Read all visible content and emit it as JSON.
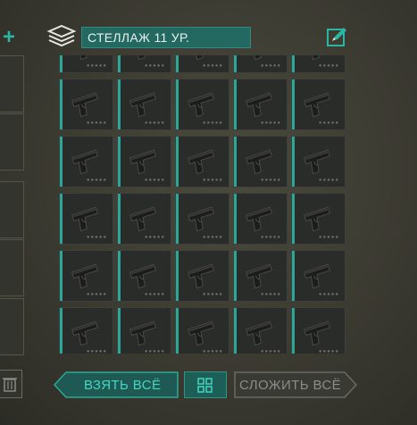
{
  "header": {
    "title": "СТЕЛЛАЖ 11 УР.",
    "storage_icon": "boxes-stack-icon",
    "edit_icon": "edit-pencil-icon"
  },
  "left_panel": {
    "add_icon": "plus-icon",
    "trash_icon": "trash-icon"
  },
  "grid": {
    "item_name": "pistol",
    "item_icon": "pistol-icon",
    "columns": 5,
    "rows_visible": 6,
    "rarity_stars": 5
  },
  "footer": {
    "take_all_label": "ВЗЯТЬ ВСЁ",
    "sort_icon": "grid-sort-icon",
    "stack_all_label": "СЛОЖИТЬ ВСЁ"
  },
  "colors": {
    "accent": "#2bb5a3",
    "title_bar": "#236961",
    "slot_bg": "#2a2c2a"
  }
}
